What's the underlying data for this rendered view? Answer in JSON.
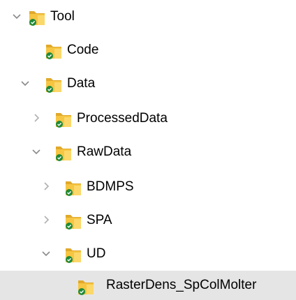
{
  "tree": {
    "items": [
      {
        "label": "Tool",
        "expander": "expanded",
        "icon": "synced-folder-icon"
      },
      {
        "label": "Code",
        "expander": "none",
        "icon": "synced-folder-icon"
      },
      {
        "label": "Data",
        "expander": "expanded",
        "icon": "synced-folder-icon"
      },
      {
        "label": "ProcessedData",
        "expander": "collapsed",
        "icon": "synced-folder-icon"
      },
      {
        "label": "RawData",
        "expander": "expanded",
        "icon": "synced-folder-icon"
      },
      {
        "label": "BDMPS",
        "expander": "collapsed",
        "icon": "synced-folder-icon"
      },
      {
        "label": "SPA",
        "expander": "collapsed",
        "icon": "synced-folder-icon"
      },
      {
        "label": "UD",
        "expander": "expanded",
        "icon": "synced-folder-icon"
      },
      {
        "label": "RasterDens_SpColMolter",
        "expander": "none",
        "icon": "synced-folder-icon",
        "selected": true
      }
    ]
  },
  "colors": {
    "folder_yellow": "#f6c542",
    "folder_front": "#fcd86a",
    "sync_green": "#1f8a3b",
    "chevron_gray": "#8a8a8a",
    "selection_bg": "#e5e5e5"
  }
}
